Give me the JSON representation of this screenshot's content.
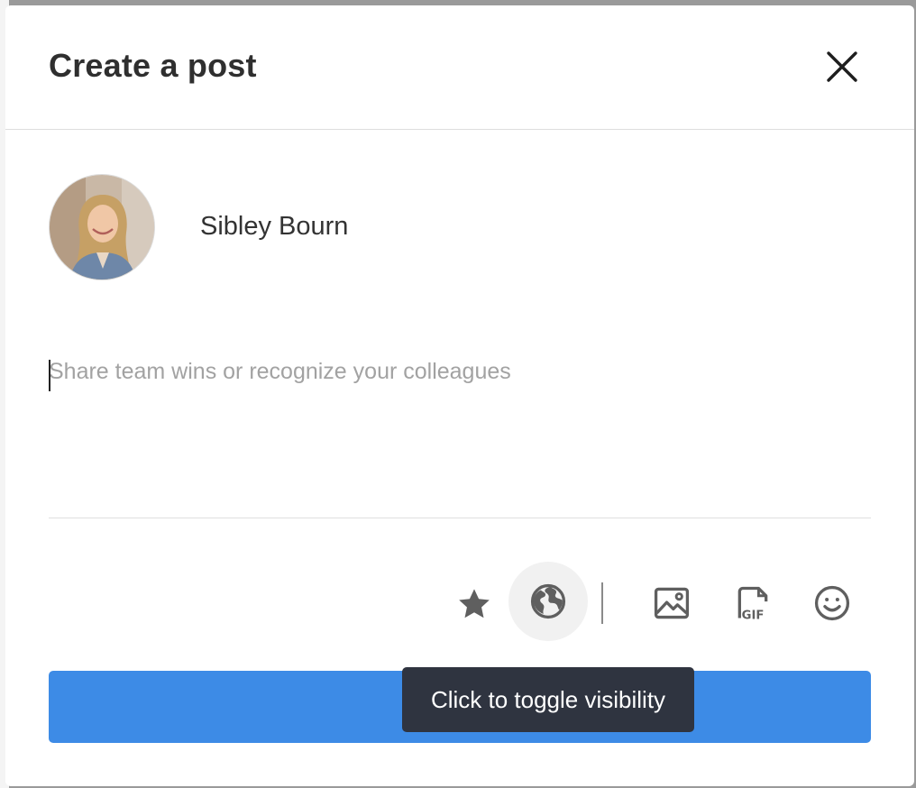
{
  "modal": {
    "title": "Create a post",
    "close_icon": "close-icon"
  },
  "author": {
    "name": "Sibley Bourn",
    "avatar": "profile-photo"
  },
  "composer": {
    "placeholder": "Share team wins or recognize your colleagues",
    "value": ""
  },
  "toolbar": {
    "items": [
      {
        "icon": "star-icon",
        "color": "#5f5f5f"
      },
      {
        "icon": "globe-icon",
        "color": "#5f5f5f",
        "active": true
      },
      {
        "icon": "image-icon",
        "color": "#5f5f5f"
      },
      {
        "icon": "gif-icon",
        "color": "#5f5f5f"
      },
      {
        "icon": "emoji-icon",
        "color": "#5f5f5f"
      }
    ]
  },
  "tooltip": {
    "text": "Click to toggle visibility"
  },
  "submit": {
    "label": "",
    "color": "#3d8be6"
  }
}
